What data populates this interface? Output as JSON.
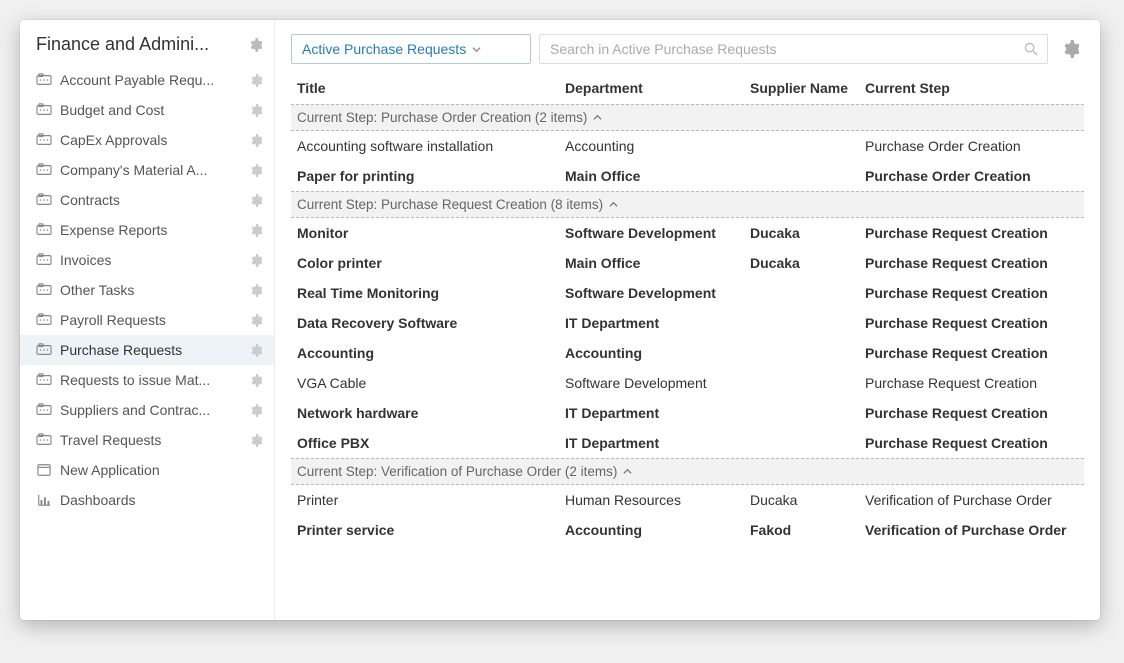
{
  "sidebar": {
    "title": "Finance and Admini...",
    "items": [
      {
        "label": "Account Payable Requ...",
        "icon": "folder",
        "gear": true
      },
      {
        "label": "Budget and Cost",
        "icon": "folder",
        "gear": true
      },
      {
        "label": "CapEx Approvals",
        "icon": "folder",
        "gear": true
      },
      {
        "label": "Company's Material A...",
        "icon": "folder",
        "gear": true
      },
      {
        "label": "Contracts",
        "icon": "folder",
        "gear": true
      },
      {
        "label": "Expense Reports",
        "icon": "folder",
        "gear": true
      },
      {
        "label": "Invoices",
        "icon": "folder",
        "gear": true
      },
      {
        "label": "Other Tasks",
        "icon": "folder",
        "gear": true
      },
      {
        "label": "Payroll Requests",
        "icon": "folder",
        "gear": true
      },
      {
        "label": "Purchase Requests",
        "icon": "folder",
        "gear": true,
        "active": true
      },
      {
        "label": "Requests to issue Mat...",
        "icon": "folder",
        "gear": true
      },
      {
        "label": "Suppliers and Contrac...",
        "icon": "folder",
        "gear": true
      },
      {
        "label": "Travel Requests",
        "icon": "folder",
        "gear": true
      },
      {
        "label": "New Application",
        "icon": "new-app",
        "gear": false
      },
      {
        "label": "Dashboards",
        "icon": "chart",
        "gear": false
      }
    ]
  },
  "toolbar": {
    "view_label": "Active Purchase Requests",
    "search_placeholder": "Search in Active Purchase Requests"
  },
  "columns": {
    "title": "Title",
    "department": "Department",
    "supplier": "Supplier Name",
    "step": "Current Step"
  },
  "groups": [
    {
      "header": "Current Step: Purchase Order Creation (2 items)",
      "rows": [
        {
          "title": "Accounting software installation",
          "department": "Accounting",
          "supplier": "",
          "step": "Purchase Order Creation",
          "bold": false
        },
        {
          "title": "Paper for printing",
          "department": "Main Office",
          "supplier": "",
          "step": "Purchase Order Creation",
          "bold": true
        }
      ]
    },
    {
      "header": "Current Step: Purchase Request Creation (8 items)",
      "rows": [
        {
          "title": "Monitor",
          "department": "Software Development",
          "supplier": "Ducaka",
          "step": "Purchase Request Creation",
          "bold": true
        },
        {
          "title": "Color printer",
          "department": "Main Office",
          "supplier": "Ducaka",
          "step": "Purchase Request Creation",
          "bold": true
        },
        {
          "title": "Real Time Monitoring",
          "department": "Software Development",
          "supplier": "",
          "step": "Purchase Request Creation",
          "bold": true
        },
        {
          "title": "Data Recovery Software",
          "department": "IT Department",
          "supplier": "",
          "step": "Purchase Request Creation",
          "bold": true
        },
        {
          "title": "Accounting",
          "department": "Accounting",
          "supplier": "",
          "step": "Purchase Request Creation",
          "bold": true
        },
        {
          "title": "VGA Cable",
          "department": "Software Development",
          "supplier": "",
          "step": "Purchase Request Creation",
          "bold": false
        },
        {
          "title": "Network hardware",
          "department": "IT Department",
          "supplier": "",
          "step": "Purchase Request Creation",
          "bold": true
        },
        {
          "title": "Office PBX",
          "department": "IT Department",
          "supplier": "",
          "step": "Purchase Request Creation",
          "bold": true
        }
      ]
    },
    {
      "header": "Current Step: Verification of Purchase Order (2 items)",
      "rows": [
        {
          "title": "Printer",
          "department": "Human Resources",
          "supplier": "Ducaka",
          "step": "Verification of Purchase Order",
          "bold": false
        },
        {
          "title": "Printer service",
          "department": "Accounting",
          "supplier": "Fakod",
          "step": "Verification of Purchase Order",
          "bold": true
        }
      ]
    }
  ]
}
